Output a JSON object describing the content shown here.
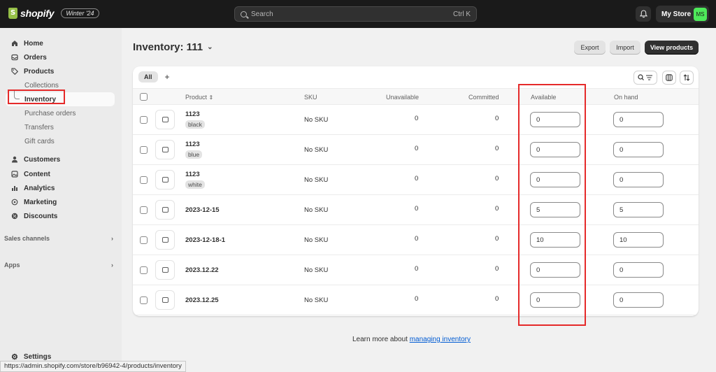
{
  "topbar": {
    "brand": "shopify",
    "edition_badge": "Winter '24",
    "search_placeholder": "Search",
    "search_shortcut": "Ctrl K",
    "store_name": "My Store",
    "store_initials": "MS"
  },
  "sidebar": {
    "items": [
      {
        "label": "Home",
        "icon": "home-icon"
      },
      {
        "label": "Orders",
        "icon": "orders-icon"
      },
      {
        "label": "Products",
        "icon": "tag-icon"
      }
    ],
    "product_subitems": [
      "Collections",
      "Inventory",
      "Purchase orders",
      "Transfers",
      "Gift cards"
    ],
    "active_subitem": "Inventory",
    "items2": [
      {
        "label": "Customers",
        "icon": "person-icon"
      },
      {
        "label": "Content",
        "icon": "content-icon"
      },
      {
        "label": "Analytics",
        "icon": "analytics-icon"
      },
      {
        "label": "Marketing",
        "icon": "marketing-icon"
      },
      {
        "label": "Discounts",
        "icon": "discount-icon"
      }
    ],
    "sales_channels": "Sales channels",
    "apps": "Apps",
    "settings": "Settings"
  },
  "page": {
    "title": "Inventory: 111",
    "export_label": "Export",
    "import_label": "Import",
    "view_products_label": "View products"
  },
  "table": {
    "tab_all": "All",
    "tab_add": "+",
    "headers": {
      "product": "Product",
      "sku": "SKU",
      "unavailable": "Unavailable",
      "committed": "Committed",
      "available": "Available",
      "on_hand": "On hand"
    },
    "rows": [
      {
        "name": "1123",
        "variant": "black",
        "sku": "No SKU",
        "unavailable": "0",
        "committed": "0",
        "available": "0",
        "on_hand": "0"
      },
      {
        "name": "1123",
        "variant": "blue",
        "sku": "No SKU",
        "unavailable": "0",
        "committed": "0",
        "available": "0",
        "on_hand": "0"
      },
      {
        "name": "1123",
        "variant": "white",
        "sku": "No SKU",
        "unavailable": "0",
        "committed": "0",
        "available": "0",
        "on_hand": "0"
      },
      {
        "name": "2023-12-15",
        "variant": "",
        "sku": "No SKU",
        "unavailable": "0",
        "committed": "0",
        "available": "5",
        "on_hand": "5"
      },
      {
        "name": "2023-12-18-1",
        "variant": "",
        "sku": "No SKU",
        "unavailable": "0",
        "committed": "0",
        "available": "10",
        "on_hand": "10"
      },
      {
        "name": "2023.12.22",
        "variant": "",
        "sku": "No SKU",
        "unavailable": "0",
        "committed": "0",
        "available": "0",
        "on_hand": "0"
      },
      {
        "name": "2023.12.25",
        "variant": "",
        "sku": "No SKU",
        "unavailable": "0",
        "committed": "0",
        "available": "0",
        "on_hand": "0"
      }
    ]
  },
  "footer": {
    "learn_prefix": "Learn more about ",
    "learn_link": "managing inventory"
  },
  "status_bar_url": "https://admin.shopify.com/store/b96942-4/products/inventory",
  "colors": {
    "highlight": "#e52a2a",
    "topbar": "#1a1a1a",
    "link": "#005bd3",
    "avatar": "#4eea5a"
  }
}
